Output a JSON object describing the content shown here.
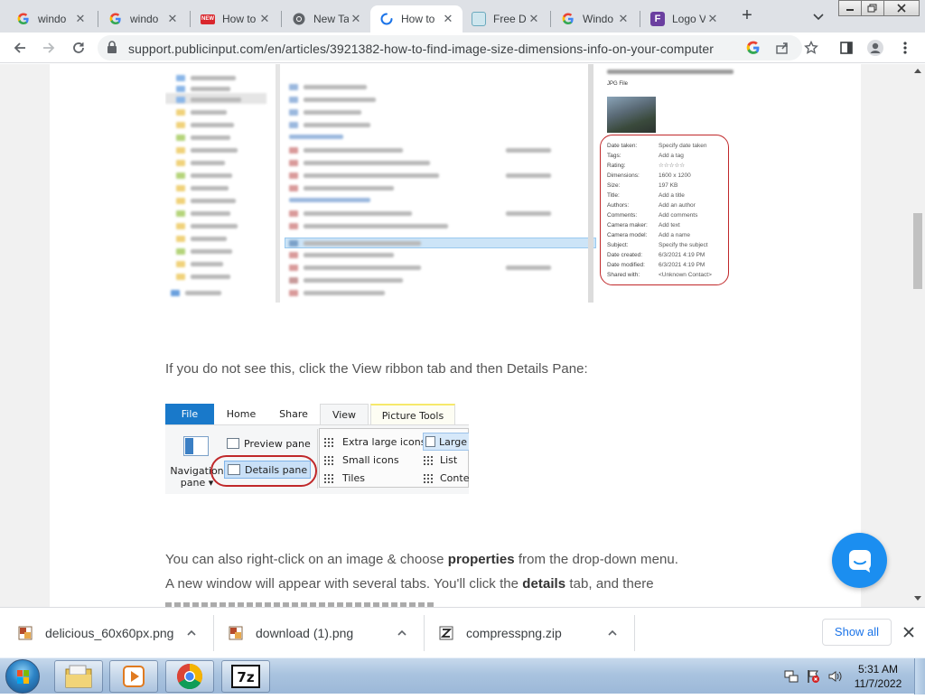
{
  "browser": {
    "tabs": [
      {
        "title": "windo",
        "favicon": "google-g-icon",
        "active": false
      },
      {
        "title": "windo",
        "favicon": "google-g-icon",
        "active": false
      },
      {
        "title": "How to",
        "favicon": "red-site-icon",
        "active": false
      },
      {
        "title": "New Ta",
        "favicon": "chrome-icon",
        "active": false
      },
      {
        "title": "How to",
        "favicon": "loading-spinner-icon",
        "active": true
      },
      {
        "title": "Free D",
        "favicon": "image-tool-icon",
        "active": false
      },
      {
        "title": "Windo",
        "favicon": "google-g-icon",
        "active": false
      },
      {
        "title": "Logo V",
        "favicon": "purple-f-icon",
        "active": false
      }
    ],
    "url": "support.publicinput.com/en/articles/3921382-how-to-find-image-size-dimensions-info-on-your-computer"
  },
  "article": {
    "explorer_screenshot": {
      "preview_type": "JPG File",
      "details": [
        {
          "key": "Date taken:",
          "value": "Specify date taken"
        },
        {
          "key": "Tags:",
          "value": "Add a tag"
        },
        {
          "key": "Rating:",
          "value": "☆☆☆☆☆"
        },
        {
          "key": "Dimensions:",
          "value": "1600 x 1200"
        },
        {
          "key": "Size:",
          "value": "197 KB"
        },
        {
          "key": "Title:",
          "value": "Add a title"
        },
        {
          "key": "Authors:",
          "value": "Add an author"
        },
        {
          "key": "Comments:",
          "value": "Add comments"
        },
        {
          "key": "Camera maker:",
          "value": "Add text"
        },
        {
          "key": "Camera model:",
          "value": "Add a name"
        },
        {
          "key": "Subject:",
          "value": "Specify the subject"
        },
        {
          "key": "Date created:",
          "value": "6/3/2021 4:19 PM"
        },
        {
          "key": "Date modified:",
          "value": "6/3/2021 4:19 PM"
        },
        {
          "key": "Shared with:",
          "value": "<Unknown Contact>"
        }
      ]
    },
    "paragraph_1": "If you do not see this, click the View ribbon tab and then Details Pane:",
    "ribbon_screenshot": {
      "tabs": {
        "file": "File",
        "home": "Home",
        "share": "Share",
        "view": "View",
        "picture_tools": "Picture Tools"
      },
      "nav_pane_line1": "Navigation",
      "nav_pane_line2": "pane ▾",
      "preview_pane": "Preview pane",
      "details_pane": "Details pane",
      "extra_large_icons": "Extra large icons",
      "large": "Large",
      "small_icons": "Small icons",
      "list": "List",
      "tiles": "Tiles",
      "content": "Conte"
    },
    "paragraph_2": {
      "line1_a": "You can also right-click on an image & choose ",
      "line1_bold": "properties",
      "line1_b": " from the drop-down menu.",
      "line2_a": "A new window will appear with several tabs. You'll click the ",
      "line2_bold": "details",
      "line2_b": " tab, and there"
    }
  },
  "downloads": {
    "items": [
      {
        "name": "delicious_60x60px.png",
        "icon": "png-file-icon"
      },
      {
        "name": "download (1).png",
        "icon": "png-file-icon"
      },
      {
        "name": "compresspng.zip",
        "icon": "zip-file-icon"
      }
    ],
    "show_all": "Show all"
  },
  "taskbar": {
    "apps": [
      "windows-explorer-icon",
      "media-player-icon",
      "chrome-icon",
      "7zip-icon"
    ],
    "time": "5:31 AM",
    "date": "11/7/2022"
  },
  "colors": {
    "accent": "#1a73e8",
    "chat": "#1b8ef0",
    "highlight_oval": "#c0282a",
    "file_tab": "#1979ca"
  }
}
